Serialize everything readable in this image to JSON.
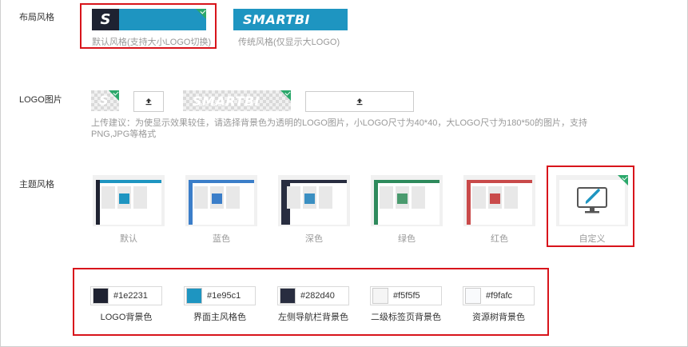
{
  "sections": {
    "layout_label": "布局风格",
    "logo_label": "LOGO图片",
    "theme_label": "主题风格"
  },
  "layout": {
    "default_caption": "默认风格(支持大小LOGO切换)",
    "traditional_caption": "传统风格(仅显示大LOGO)",
    "logo_text": "SMARTBI",
    "small_logo_text": "S"
  },
  "logo": {
    "hint": "上传建议：为使显示效果较佳，请选择背景色为透明的LOGO图片，小LOGO尺寸为40*40，大LOGO尺寸为180*50的图片，支持PNG,JPG等格式"
  },
  "themes": [
    {
      "label": "默认",
      "top": "#1e95c1",
      "side": "#1e2231",
      "center": "#1e95c1"
    },
    {
      "label": "蓝色",
      "top": "#3b7ec9",
      "side": "#3b7ec9",
      "center": "#3b7ec9"
    },
    {
      "label": "深色",
      "top": "#282d40",
      "side": "#282d40",
      "center": "#3b8fc2"
    },
    {
      "label": "绿色",
      "top": "#2e8a5c",
      "side": "#2e8a5c",
      "center": "#4a9a6e"
    },
    {
      "label": "红色",
      "top": "#c94a4a",
      "side": "#c94a4a",
      "center": "#c94a4a"
    },
    {
      "label": "自定义",
      "icon": "monitor-brush-icon"
    }
  ],
  "colors": [
    {
      "hex": "#1e2231",
      "label": "LOGO背景色"
    },
    {
      "hex": "#1e95c1",
      "label": "界面主风格色"
    },
    {
      "hex": "#282d40",
      "label": "左侧导航栏背景色"
    },
    {
      "hex": "#f5f5f5",
      "label": "二级标签页背景色"
    },
    {
      "hex": "#f9fafc",
      "label": "资源树背景色"
    }
  ],
  "accent": {
    "selected_border": "#d8141b",
    "check": "#2ba86b"
  },
  "icons": {
    "upload": "upload-icon",
    "check": "check-icon"
  }
}
